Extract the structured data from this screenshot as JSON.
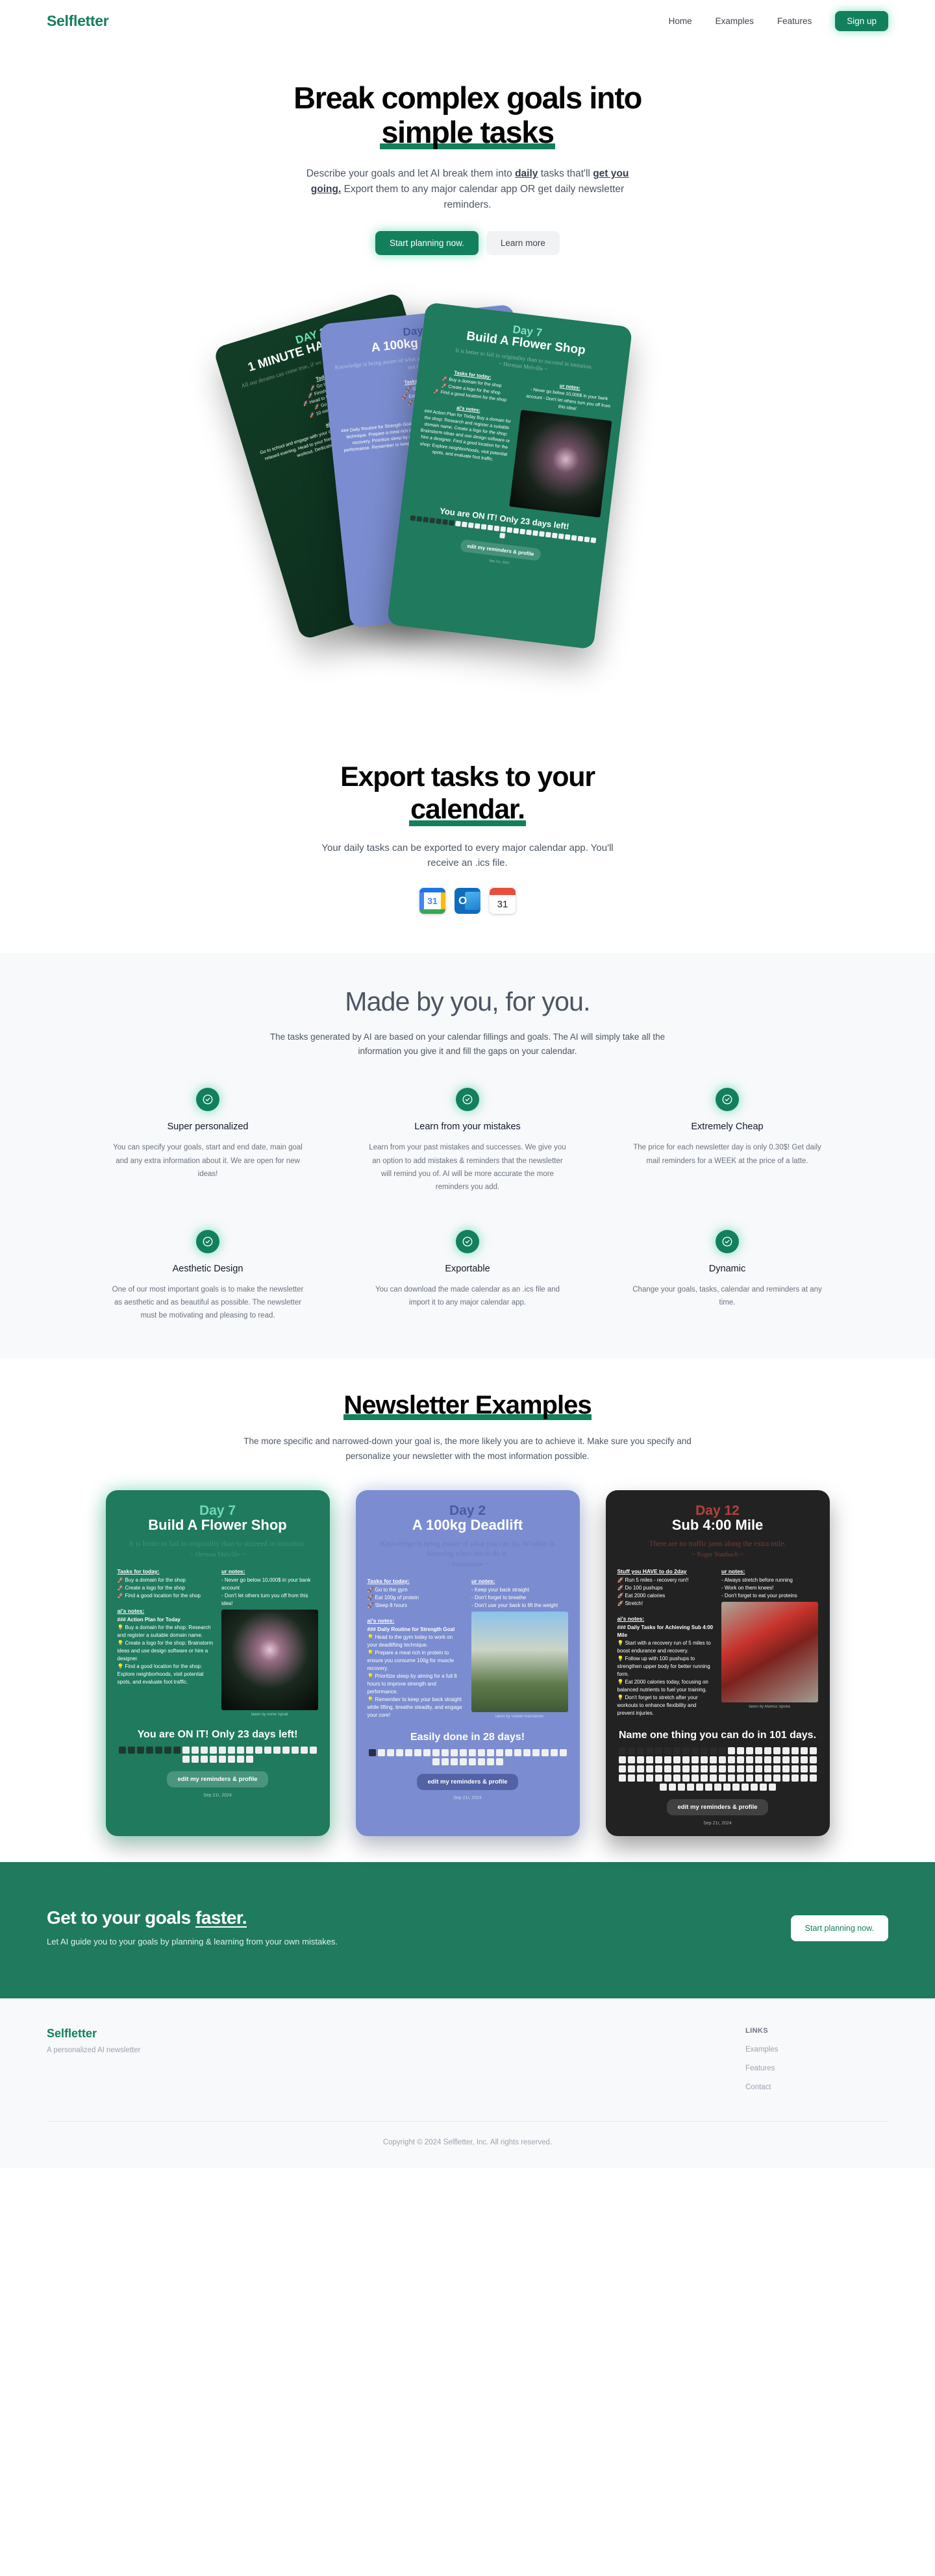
{
  "nav": {
    "brand": "Selfletter",
    "links": [
      {
        "label": "Home"
      },
      {
        "label": "Examples"
      },
      {
        "label": "Features"
      }
    ],
    "signup": "Sign up"
  },
  "hero": {
    "title_line1": "Break complex goals into",
    "title_line2": "simple tasks",
    "sub_a": "Describe your goals and let AI break them into ",
    "sub_b": "daily",
    "sub_c": " tasks that'll ",
    "sub_d": "get you going.",
    "sub_e": " Export them to any major calendar app OR get daily newsletter reminders.",
    "btn_primary": "Start planning now.",
    "btn_secondary": "Learn more"
  },
  "stack": [
    {
      "day": "DAY 3",
      "title": "1 MINUTE HANDSTAND",
      "quote": "All our dreams can come true, if we have the courage to pursue them.",
      "tasks_header": "Today:",
      "tasks": [
        "Go to school",
        "Finish homework",
        "Head to friends meeting",
        "Go to the gym",
        "10 minute handstand"
      ],
      "notes_header": "ai's notes:",
      "notes": "Go to school and engage with your classes. Finish homework before meeting for a relaxed evening. Head to your friends meeting and engage. Go to the gym for a workout. Dedicate time to 10 minute handstand."
    },
    {
      "day": "Day 2",
      "title": "A 100kg Deadlift",
      "quote": "Knowledge is being aware of what you can do. Wisdom is knowing when not to do it.",
      "tasks_header": "Tasks for today:",
      "tasks": [
        "Go to the gym",
        "Eat 100g of protein",
        "Sleep 8 hours"
      ],
      "notes_header": "ai's notes:",
      "notes": "### Daily Routine for Strength Goal Head to the gym today to work on your deadlifting technique. Prepare a meal rich in protein to ensure you consume 100g for muscle recovery. Prioritize sleep by aiming for a full 8 hours to improve strength and performance. Remember to keep your back straight while lifting, breathe steadily, and engage your core!"
    },
    {
      "day": "Day 7",
      "title": "Build A Flower Shop",
      "quote": "It is better to fail in originality than to succeed in imitation.",
      "author": "~ Herman Melville ~",
      "tasks_header": "Tasks for today:",
      "tasks": [
        "Buy a domain for the shop",
        "Create a logo for the shop",
        "Find a good location for the shop"
      ],
      "notes_header": "ai's notes:",
      "notes": "### Action Plan for Today Buy a domain for the shop: Research and register a suitable domain name. Create a logo for the shop: Brainstorm ideas and use design software or hire a designer. Find a good location for the shop: Explore neighborhoods, visit potential spots, and evaluate foot traffic.",
      "ur_notes_header": "ur notes:",
      "ur_notes": "- Never go below 10,000$ in your bank account - Don't let others turn you off from this idea!",
      "banner": "You are ON IT! Only 23 days left!",
      "edit": "edit my reminders & profile",
      "date": "Sep 21r, 2024"
    }
  ],
  "export": {
    "title_line1": "Export tasks to your",
    "title_line2": "calendar.",
    "sub": "Your daily tasks can be exported to every major calendar app. You'll receive an .ics file.",
    "icons": [
      {
        "name": "google-calendar-icon",
        "glyph": "31"
      },
      {
        "name": "outlook-calendar-icon",
        "glyph": "O"
      },
      {
        "name": "apple-calendar-icon",
        "glyph": "31"
      }
    ]
  },
  "madeby": {
    "title": "Made by you, for you.",
    "sub": "The tasks generated by AI are based on your calendar fillings and goals. The AI will simply take all the information you give it and fill the gaps on your calendar.",
    "features": [
      {
        "icon": "check-circle-icon",
        "title": "Super personalized",
        "desc": "You can specify your goals, start and end date, main goal and any extra information about it. We are open for new ideas!"
      },
      {
        "icon": "check-circle-icon",
        "title": "Learn from your mistakes",
        "desc": "Learn from your past mistakes and successes. We give you an option to add mistakes & reminders that the newsletter will remind you of. AI will be more accurate the more reminders you add."
      },
      {
        "icon": "check-circle-icon",
        "title": "Extremely Cheap",
        "desc": "The price for each newsletter day is only 0.30$! Get daily mail reminders for a WEEK at the price of a latte."
      },
      {
        "icon": "check-circle-icon",
        "title": "Aesthetic Design",
        "desc": "One of our most important goals is to make the newsletter as aesthetic and as beautiful as possible. The newsletter must be motivating and pleasing to read."
      },
      {
        "icon": "check-circle-icon",
        "title": "Exportable",
        "desc": "You can download the made calendar as an .ics file and import it to any major calendar app."
      },
      {
        "icon": "check-circle-icon",
        "title": "Dynamic",
        "desc": "Change your goals, tasks, calendar and reminders at any time."
      }
    ]
  },
  "examples": {
    "title": "Newsletter Examples",
    "sub": "The more specific and narrowed-down your goal is, the more likely you are to achieve it. Make sure you specify and personalize your newsletter with the most information possible.",
    "cards": [
      {
        "theme": "green",
        "day": "Day 7",
        "title": "Build A Flower Shop",
        "quote": "It is better to fail in originality than to succeed in imitation.",
        "author": "~ Herman Melville ~",
        "tasks_header": "Tasks for today:",
        "tasks": [
          "Buy a domain for the shop",
          "Create a logo for the shop",
          "Find a good location for the shop"
        ],
        "ur_notes_header": "ur notes:",
        "ur_notes": "- Never go below 10,000$ in your bank account\n- Don't let others turn you off from this idea!",
        "ai_notes_header": "ai's notes:",
        "ai_notes_intro": "### Action Plan for Today",
        "ai_notes": [
          "Buy a domain for the shop: Research and register a suitable domain name.",
          "Create a logo for the shop: Brainstorm ideas and use design software or hire a designer.",
          "Find a good location for the shop: Explore neighborhoods, visit potential spots, and evaluate foot traffic."
        ],
        "photo": "flower-photo",
        "credit": "taken by Annie Spratt",
        "banner": "You are ON IT! Only 23 days left!",
        "boxes_total": 30,
        "boxes_done": 7,
        "edit": "edit my reminders & profile",
        "date": "Sep 21r, 2024"
      },
      {
        "theme": "blue",
        "day": "Day 2",
        "title": "A 100kg Deadlift",
        "quote": "Knowledge is being aware of what you can do. Wisdom is knowing when not to do it.",
        "author": "~ Anonymous ~",
        "tasks_header": "Tasks for today:",
        "tasks": [
          "Go to the gym",
          "Eat 100g of protein",
          "Sleep 8 hours"
        ],
        "ur_notes_header": "ur notes:",
        "ur_notes": "- Keep your back straight\n- Don't forget to breathe\n- Don't use your back to lift the weight",
        "ai_notes_header": "ai's notes:",
        "ai_notes_intro": "### Daily Routine for Strength Goal",
        "ai_notes": [
          "Head to the gym today to work on your deadlifting technique.",
          "Prepare a meal rich in protein to ensure you consume 100g for muscle recovery.",
          "Prioritize sleep by aiming for a full 8 hours to improve strength and performance.",
          "Remember to keep your back straight while lifting, breathe steadily, and engage your core!"
        ],
        "photo": "statue-photo",
        "credit": "taken by Vladan Raznatovic",
        "banner": "Easily done in 28 days!",
        "boxes_total": 30,
        "boxes_done": 1,
        "edit": "edit my reminders & profile",
        "date": "Sep 21r, 2024"
      },
      {
        "theme": "dark",
        "day": "Day 12",
        "title": "Sub 4:00 Mile",
        "quote": "There are no traffic jams along the extra mile.",
        "author": "~ Roger Staubach ~",
        "tasks_header": "Stuff you HAVE to do 2day",
        "tasks": [
          "Run 5 miles - recovery run!!",
          "Do 100 pushups",
          "Eat 2000 calories",
          "Stretch!"
        ],
        "ur_notes_header": "ur notes:",
        "ur_notes": "- Always stretch before running\n- Work on them knees!\n- Don't forget to eat your proteins",
        "ai_notes_header": "ai's notes:",
        "ai_notes_intro": "### Daily Tasks for Achieving Sub 4:00 Mile",
        "ai_notes": [
          "Start with a recovery run of 5 miles to boost endurance and recovery.",
          "Follow up with 100 pushups to strengthen upper body for better running form.",
          "Eat 2000 calories today, focusing on balanced nutrients to fuel your training.",
          "Don't forget to stretch after your workouts to enhance flexibility and prevent injuries."
        ],
        "photo": "car-photo",
        "credit": "taken by Markus Spiske",
        "banner": "Name one thing you can do in 101 days.",
        "boxes_total": 101,
        "boxes_done": 12,
        "edit": "edit my reminders & profile",
        "date": "Sep 21r, 2024"
      }
    ]
  },
  "cta": {
    "title_a": "Get to your goals ",
    "title_b": "faster.",
    "sub": "Let AI guide you to your goals by planning & learning from your own mistakes.",
    "button": "Start planning now."
  },
  "footer": {
    "brand": "Selfletter",
    "tagline": "A personalized AI newsletter",
    "links_header": "LINKS",
    "links": [
      {
        "label": "Examples"
      },
      {
        "label": "Features"
      },
      {
        "label": "Contact"
      }
    ],
    "copyright": "Copyright © 2024 Selfletter, Inc. All rights reserved."
  },
  "colors": {
    "brand_green": "#12805c",
    "card_green": "#1f7a5e",
    "card_blue": "#7b8dd0",
    "card_dark": "#232223",
    "muted": "#6b7280"
  }
}
